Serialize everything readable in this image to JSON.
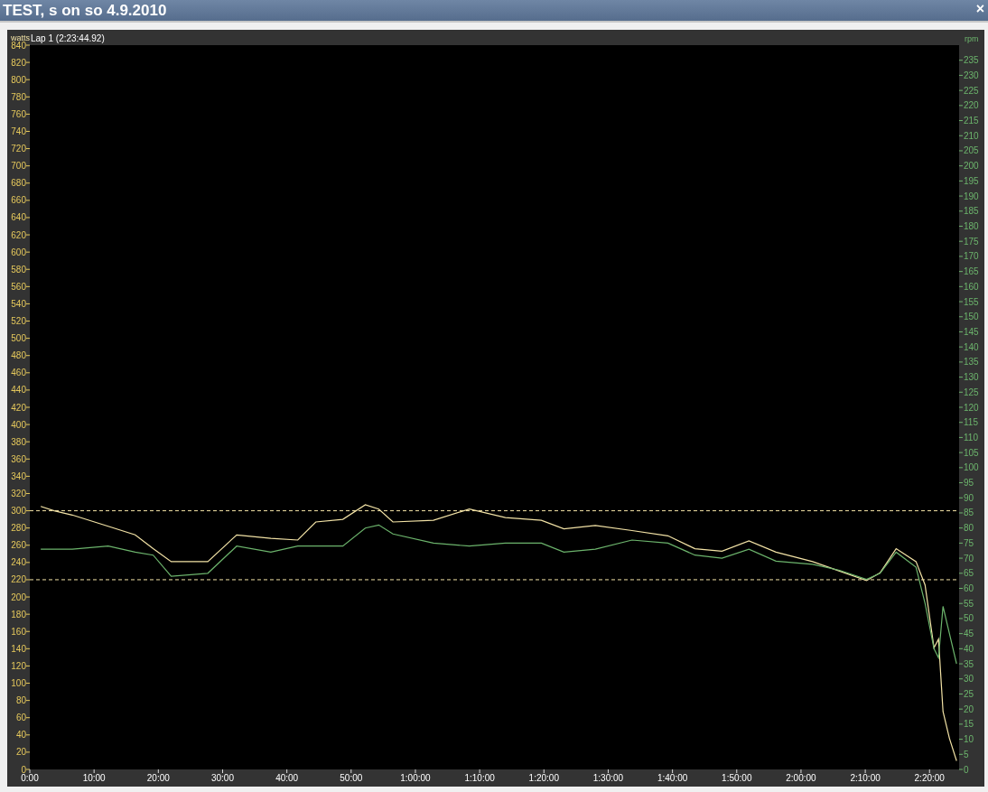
{
  "window": {
    "title": "TEST, s on so 4.9.2010",
    "close": "×"
  },
  "chart": {
    "chart_data": {
      "type": "line",
      "title": "Lap 1 (2:23:44.92)",
      "xlim": [
        0,
        144.6
      ],
      "ylim": [
        0,
        840
      ],
      "y2lim": [
        0,
        240
      ],
      "x": [
        1.7,
        3.8,
        6.6,
        12.2,
        16.4,
        19.2,
        22.0,
        27.7,
        32.2,
        37.5,
        41.7,
        44.5,
        48.7,
        52.2,
        54.3,
        56.5,
        62.8,
        68.4,
        74.0,
        79.6,
        83.1,
        88.0,
        93.7,
        99.3,
        103.5,
        107.7,
        111.9,
        116.1,
        121.8,
        126.0,
        130.2,
        132.3,
        134.8,
        137.9,
        139.3,
        140.7,
        141.4,
        142.1,
        143.1,
        144.2
      ],
      "series": [
        {
          "name": "watts",
          "color": "#f3e3a6",
          "values": [
            305,
            300,
            295,
            282,
            272,
            256,
            241,
            241,
            272,
            268,
            266,
            287,
            290,
            307,
            302,
            287,
            289,
            302,
            292,
            289,
            279,
            283,
            277,
            271,
            256,
            253,
            265,
            252,
            241,
            230,
            219,
            228,
            256,
            241,
            214,
            141,
            151,
            67,
            36,
            10
          ]
        },
        {
          "name": "rpm",
          "color": "#6cb46c",
          "axis": "y2",
          "values": [
            73,
            73,
            73,
            74,
            72,
            71,
            64,
            65,
            74,
            72,
            74,
            74,
            74,
            80,
            81,
            78,
            75,
            74,
            75,
            75,
            72,
            73,
            76,
            75,
            71,
            70,
            73,
            69,
            68,
            66,
            63,
            65,
            72,
            67,
            55,
            40,
            37,
            54,
            45,
            35
          ]
        }
      ],
      "xticks": [
        {
          "value": 0,
          "label": "0:00"
        },
        {
          "value": 10,
          "label": "10:00"
        },
        {
          "value": 20,
          "label": "20:00"
        },
        {
          "value": 30,
          "label": "30:00"
        },
        {
          "value": 40,
          "label": "40:00"
        },
        {
          "value": 50,
          "label": "50:00"
        },
        {
          "value": 60,
          "label": "1:00:00"
        },
        {
          "value": 70,
          "label": "1:10:00"
        },
        {
          "value": 80,
          "label": "1:20:00"
        },
        {
          "value": 90,
          "label": "1:30:00"
        },
        {
          "value": 100,
          "label": "1:40:00"
        },
        {
          "value": 110,
          "label": "1:50:00"
        },
        {
          "value": 120,
          "label": "2:00:00"
        },
        {
          "value": 130,
          "label": "2:10:00"
        },
        {
          "value": 140,
          "label": "2:20:00"
        }
      ],
      "yticks": [
        0,
        20,
        40,
        60,
        80,
        100,
        120,
        140,
        160,
        180,
        200,
        220,
        240,
        260,
        280,
        300,
        320,
        340,
        360,
        380,
        400,
        420,
        440,
        460,
        480,
        500,
        520,
        540,
        560,
        580,
        600,
        620,
        640,
        660,
        680,
        700,
        720,
        740,
        760,
        780,
        800,
        820,
        840
      ],
      "y2ticks": [
        0,
        5,
        10,
        15,
        20,
        25,
        30,
        35,
        40,
        45,
        50,
        55,
        60,
        65,
        70,
        75,
        80,
        85,
        90,
        95,
        100,
        105,
        110,
        115,
        120,
        125,
        130,
        135,
        140,
        145,
        150,
        155,
        160,
        165,
        170,
        175,
        180,
        185,
        190,
        195,
        200,
        205,
        210,
        215,
        220,
        225,
        230,
        235
      ],
      "ref_lines": [
        {
          "axis": "y",
          "value": 300
        },
        {
          "axis": "y",
          "value": 220
        }
      ]
    }
  }
}
